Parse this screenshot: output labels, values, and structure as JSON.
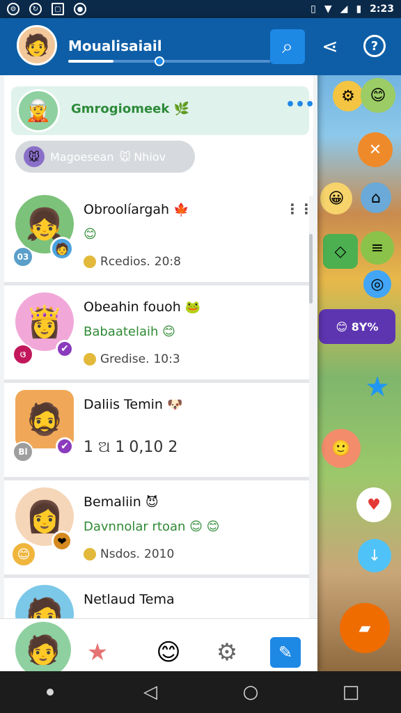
{
  "status_bar": {
    "time": "2:23",
    "icons": [
      "settings-icon",
      "sync-icon",
      "screenshot-icon",
      "app-icon",
      "vibrate-icon",
      "wifi-icon",
      "signal-icon",
      "battery-icon"
    ]
  },
  "header": {
    "title": "Moualisaiail",
    "search_icon": "search-icon",
    "share_icon": "share-icon",
    "help_icon": "help-icon",
    "help_glyph": "?",
    "progress": 0.45
  },
  "group": {
    "name": "Gmrogiomeek",
    "emoji": "🌿",
    "more_label": "•••"
  },
  "filter_pill": {
    "label": "Magoesean",
    "emoji": "🐭",
    "label2": "Nhiov"
  },
  "chats": [
    {
      "name": "Obroolíargah",
      "name_emoji": "🍁",
      "subtitle": "",
      "subtitle_emoji": "😊",
      "meta": "Rcedios.",
      "meta_extra": "20:8",
      "badge": "03",
      "avatar_color": "#7cc27a",
      "mini_color": "#4aa3df",
      "badge_color": "#5a9fc9",
      "more": "⋮⋮"
    },
    {
      "name": "Obeahin fouoh",
      "name_emoji": "🐸",
      "subtitle": "Babaatelaih",
      "subtitle_emoji": "😊",
      "meta": "Gredise.",
      "meta_extra": "10:3",
      "badge": "ଓ",
      "avatar_color": "#f1a8d8",
      "mini_color": "#8b3bbd",
      "badge_color": "#c2185b",
      "more": ""
    },
    {
      "name": "Daliis Temin",
      "name_emoji": "🐶",
      "subtitle": "",
      "subtitle_emoji": "",
      "meta": "1 ଅ 1",
      "meta_extra": "0,10 2",
      "badge": "Bl",
      "avatar_color": "#f0a858",
      "mini_color": "#8b3bbd",
      "badge_color": "#9e9e9e",
      "more": ""
    },
    {
      "name": "Bemaliin",
      "name_emoji": "😈",
      "subtitle": "Davnnolar rtoan",
      "subtitle_emoji": "😊 😊",
      "meta": "Nsdos.",
      "meta_extra": "2010",
      "badge": "😊",
      "avatar_color": "#f6d6b8",
      "mini_color": "#d48a1e",
      "badge_color": "#f0b53c",
      "more": ""
    },
    {
      "name": "Netlaud Tema",
      "name_emoji": "",
      "subtitle": "",
      "subtitle_emoji": "",
      "meta": "",
      "meta_extra": "",
      "badge": "",
      "avatar_color": "#7cc8e8",
      "mini_color": "#2e7d32",
      "badge_color": "#ffffff",
      "more": ""
    }
  ],
  "tabs": [
    {
      "name": "tab-profile",
      "icon": "profile-icon",
      "glyph": "🧑"
    },
    {
      "name": "tab-favorites",
      "icon": "star-icon",
      "glyph": "★"
    },
    {
      "name": "tab-emoji",
      "icon": "emoji-icon",
      "glyph": "😊"
    },
    {
      "name": "tab-game",
      "icon": "bomb-icon",
      "glyph": "⚙"
    },
    {
      "name": "tab-compose",
      "icon": "compose-icon",
      "glyph": "✎"
    }
  ],
  "nav": {
    "back": "◁",
    "home": "○",
    "recents": "□"
  }
}
